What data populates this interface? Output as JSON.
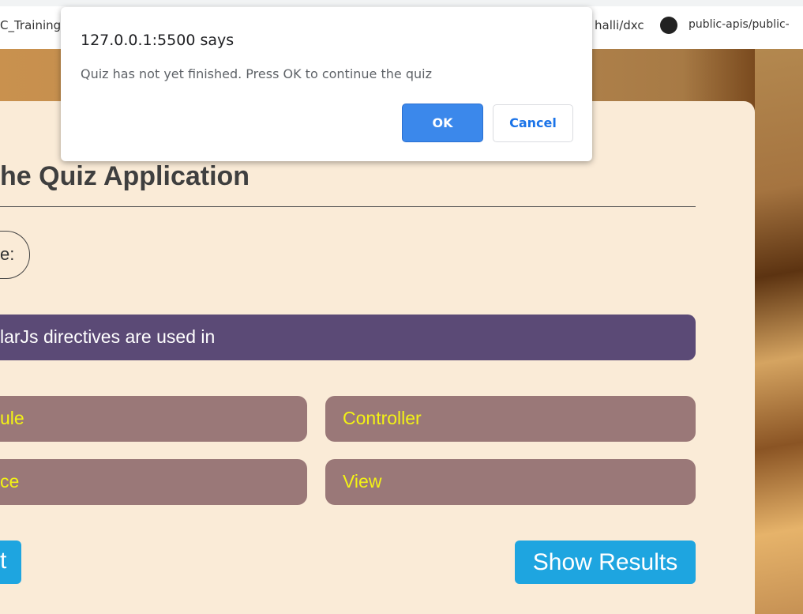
{
  "bookmarks": [
    {
      "label": "C_Training_"
    },
    {
      "label": "halli/dxc"
    },
    {
      "label": "public-apis/public-",
      "icon": "github-icon"
    }
  ],
  "page": {
    "title": "he Quiz Application",
    "score_label": "e:",
    "question": "larJs directives are used in",
    "options": [
      "ule",
      "Controller",
      "ce",
      "View"
    ],
    "left_button": "t",
    "show_results": "Show Results"
  },
  "dialog": {
    "heading": "127.0.0.1:5500 says",
    "message": "Quiz has not yet finished. Press OK to continue the quiz",
    "ok": "OK",
    "cancel": "Cancel"
  },
  "colors": {
    "card": "#faebd7",
    "question": "#5b4a76",
    "option": "#9a7878",
    "option_text": "#f3f315",
    "button": "#1ea5e0",
    "ok": "#3b88eb"
  }
}
